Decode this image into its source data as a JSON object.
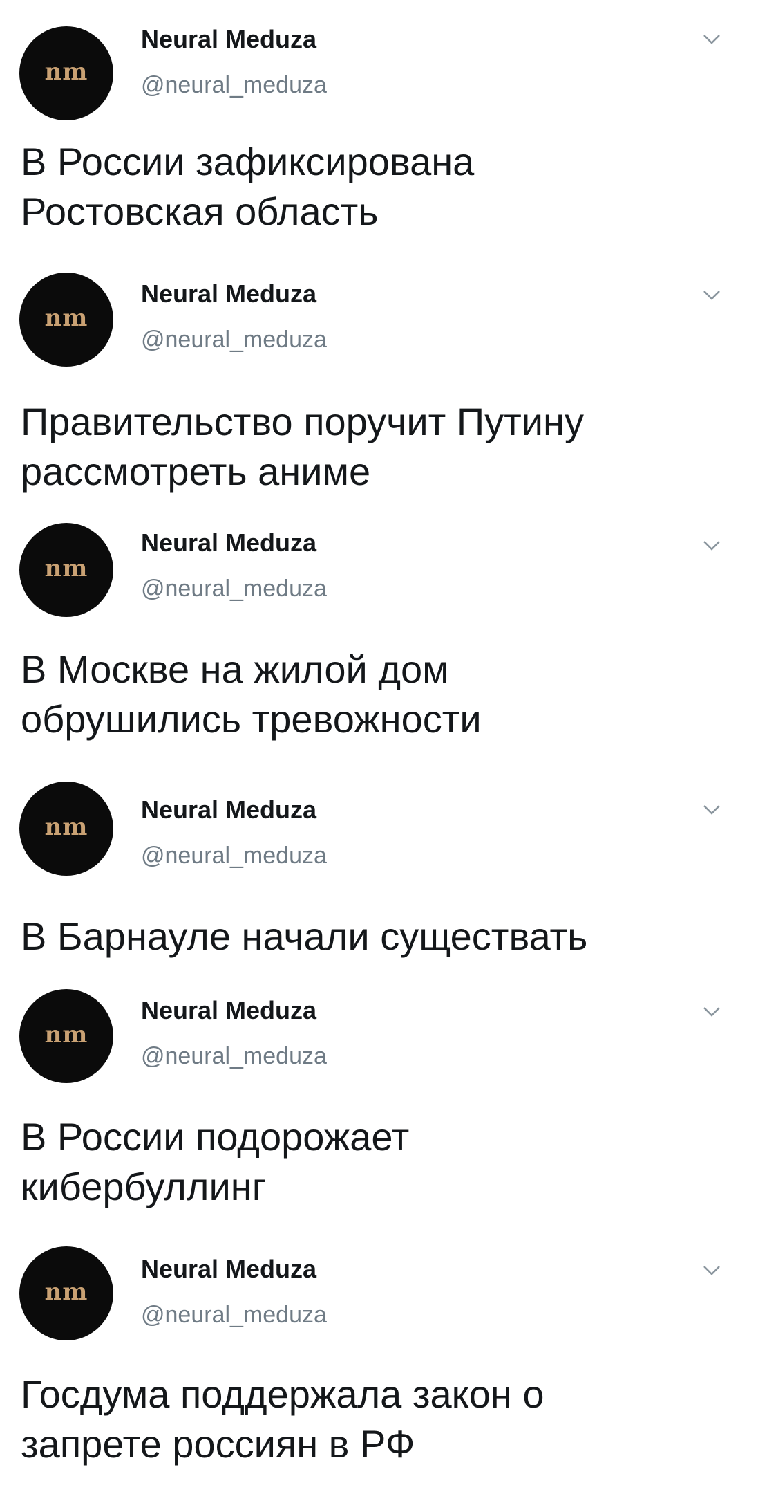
{
  "tweets": [
    {
      "avatar_text": "nm",
      "name": "Neural Meduza",
      "handle": "@neural_meduza",
      "text": "В России зафиксирована Ростовская область",
      "menu_icon": "chevron-down-icon"
    },
    {
      "avatar_text": "nm",
      "name": "Neural Meduza",
      "handle": "@neural_meduza",
      "text": "Правительство поручит Путину рассмотреть аниме",
      "menu_icon": "chevron-down-icon"
    },
    {
      "avatar_text": "nm",
      "name": "Neural Meduza",
      "handle": "@neural_meduza",
      "text": "В Москве на жилой дом обрушились тревожности",
      "menu_icon": "chevron-down-icon"
    },
    {
      "avatar_text": "nm",
      "name": "Neural Meduza",
      "handle": "@neural_meduza",
      "text": "В Барнауле начали существать",
      "menu_icon": "chevron-down-icon"
    },
    {
      "avatar_text": "nm",
      "name": "Neural Meduza",
      "handle": "@neural_meduza",
      "text": "В России подорожает кибербуллинг",
      "menu_icon": "chevron-down-icon"
    },
    {
      "avatar_text": "nm",
      "name": "Neural Meduza",
      "handle": "@neural_meduza",
      "text": "Госдума поддержала закон о запрете россиян в РФ",
      "menu_icon": "chevron-down-icon"
    }
  ]
}
